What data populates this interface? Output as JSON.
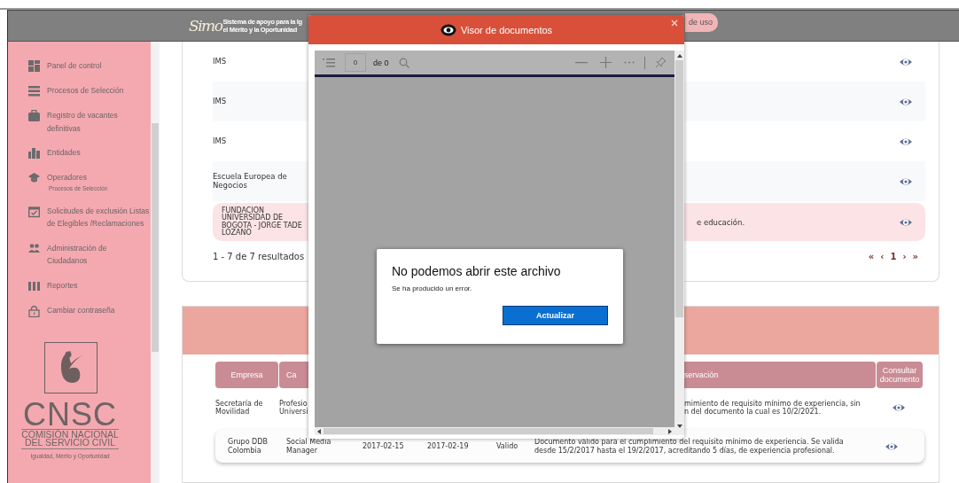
{
  "header": {
    "logo_text": "Simo",
    "tagline": [
      "Sistema de apoyo para la Ig",
      "el Mérito y la Oportunidad"
    ],
    "terms_button": "de uso"
  },
  "sidebar": {
    "items": [
      {
        "label": "Panel de control"
      },
      {
        "label": "Procesos de Selección"
      },
      {
        "label": "Registro de vacantes\ndefinitivas"
      },
      {
        "label": "Entidades"
      },
      {
        "label": "Operadores",
        "sublabel": "Procesos de Selección"
      },
      {
        "label": "Solicitudes de exclusión Listas\nde Elegibles /Reclamaciones"
      },
      {
        "label": "Administración de\nCiudadanos"
      },
      {
        "label": "Reportes"
      },
      {
        "label": "Cambiar contraseña"
      }
    ],
    "logo": {
      "acronym": "CNSC",
      "name_lines": [
        "COMISIÓN NACIONAL",
        "DEL SERVICIO CIVIL"
      ],
      "motto": "Igualdad, Mérito y Oportunidad"
    }
  },
  "institutions": {
    "rows": [
      {
        "name": "IMS",
        "highlighted": false
      },
      {
        "name": "IMS",
        "highlighted": false
      },
      {
        "name": "IMS",
        "highlighted": false
      },
      {
        "name": "Escuela Europea de\nNegocios",
        "highlighted": false
      },
      {
        "name": "FUNDACION\nUNIVERSIDAD DE\nBOGOTA - JORGE TADE\nLOZANO",
        "detail": "e educación.",
        "highlighted": true
      }
    ],
    "results": "1 - 7 de 7 resultados",
    "pagination": [
      "«",
      "‹",
      "1",
      "›",
      "»"
    ]
  },
  "experience": {
    "columns": [
      "Empresa",
      "Ca",
      "servación",
      "Consultar documento"
    ],
    "partial_row": {
      "company": "Secretaría de Movilidad",
      "position": "Profesio\nUniversi",
      "observation": "mimiento de requisito mínimo de experiencia, sin\nn del documento la cual es 10/2/2021."
    },
    "rows": [
      {
        "company": "Grupo DDB Colombia",
        "position": "Social Media Manager",
        "start": "2017-02-15",
        "end": "2017-02-19",
        "status": "Valido",
        "observation": "Documento válido para el cumplimiento del requisito mínimo de experiencia. Se valida desde 15/2/2017 hasta el 19/2/2017, acreditando 5 días, de experiencia profesional.",
        "highlighted": true
      }
    ]
  },
  "viewer": {
    "title": "Visor de documentos",
    "page_value": "0",
    "page_count": "de 0",
    "error": {
      "title": "No podemos abrir este archivo",
      "message": "Se ha producido un error.",
      "button": "Actualizar"
    }
  }
}
